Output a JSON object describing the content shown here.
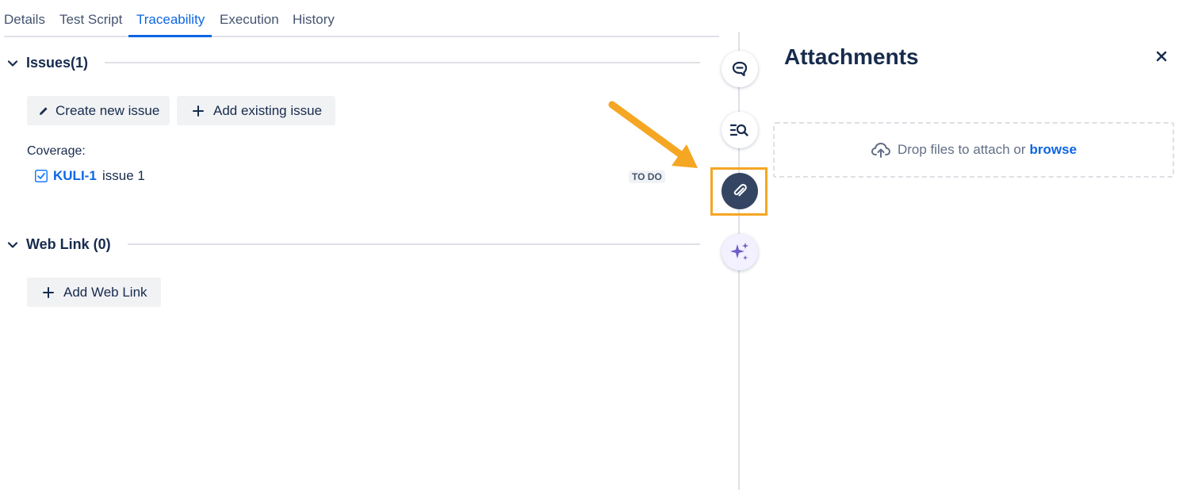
{
  "tabs": [
    {
      "label": "Details"
    },
    {
      "label": "Test Script"
    },
    {
      "label": "Traceability"
    },
    {
      "label": "Execution"
    },
    {
      "label": "History"
    }
  ],
  "active_tab": "Traceability",
  "issues_section": {
    "title": "Issues(1)",
    "create_button": "Create new issue",
    "add_existing_button": "Add existing issue",
    "coverage_label": "Coverage:",
    "items": [
      {
        "key": "KULI-1",
        "summary": "issue 1",
        "status": "TO DO"
      }
    ]
  },
  "weblink_section": {
    "title": "Web Link (0)",
    "add_button": "Add Web Link"
  },
  "rail": {
    "icons": [
      "comment-icon",
      "search-list-icon",
      "paperclip-icon",
      "ai-sparkle-icon"
    ],
    "active": "paperclip-icon"
  },
  "attachments_panel": {
    "title": "Attachments",
    "drop_text": "Drop files to attach or",
    "browse_label": "browse"
  },
  "colors": {
    "accent": "#0c66e4",
    "highlight": "#f5a623",
    "active_rail": "#344563",
    "ai_purple": "#6e5dc6"
  }
}
